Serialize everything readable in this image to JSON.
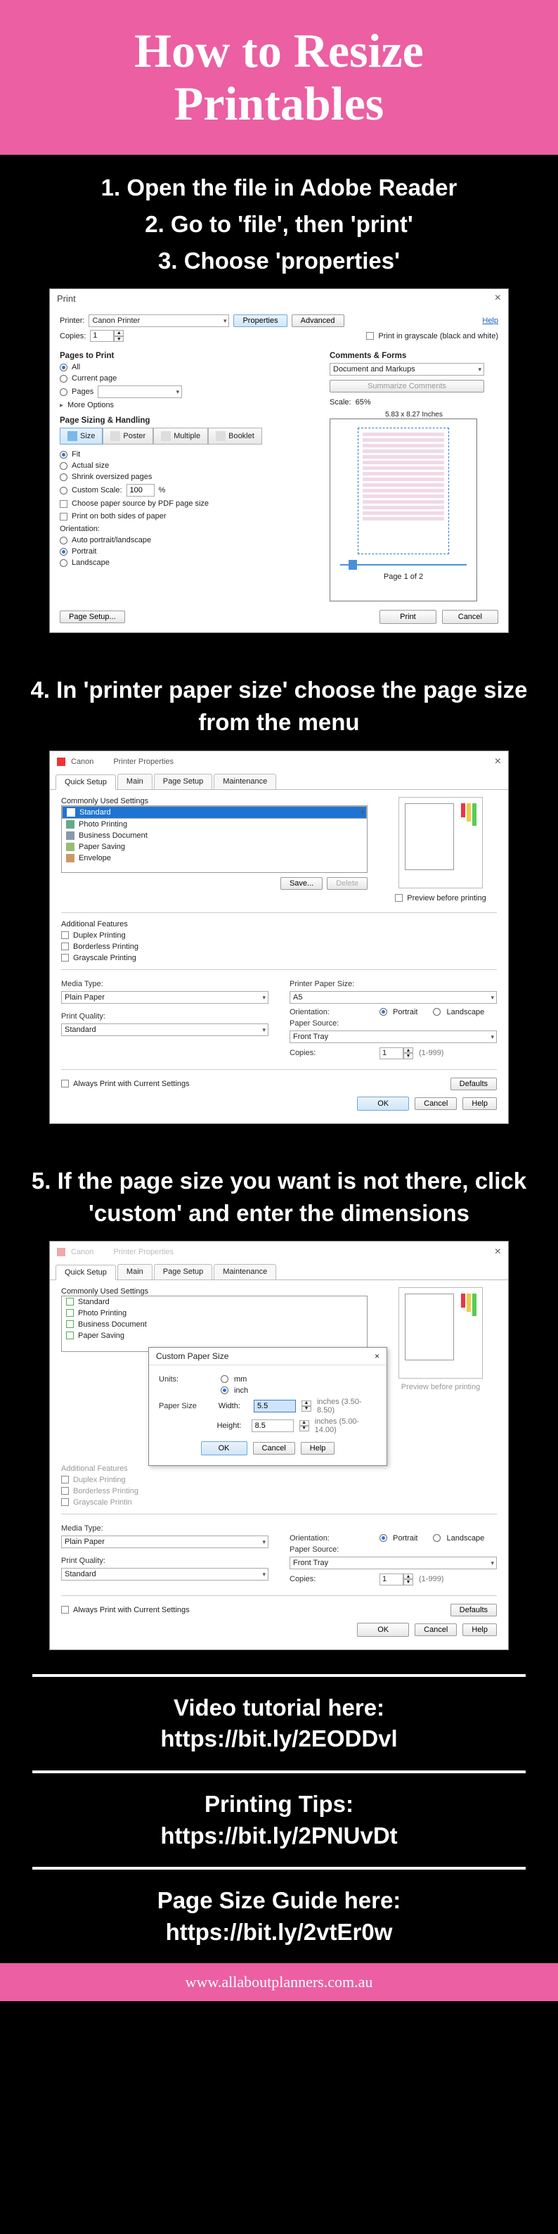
{
  "header": {
    "line1": "How to Resize",
    "line2": "Printables"
  },
  "steps": {
    "s1": "1. Open the file in Adobe Reader",
    "s2": "2. Go to 'file', then 'print'",
    "s3": "3. Choose 'properties'",
    "s4": "4. In 'printer paper size' choose the page size from the menu",
    "s5": "5. If the page size you want is not there, click 'custom' and enter the dimensions"
  },
  "print_dialog": {
    "title": "Print",
    "help": "Help",
    "printer_label": "Printer:",
    "printer_name": "Canon          Printer",
    "copies_label": "Copies:",
    "copies": "1",
    "properties_btn": "Properties",
    "advanced_btn": "Advanced",
    "grayscale": "Print in grayscale (black and white)",
    "pages_section": "Pages to Print",
    "all": "All",
    "current": "Current page",
    "pages": "Pages",
    "more_options": "More Options",
    "comments_section": "Comments & Forms",
    "comments_value": "Document and Markups",
    "summarize": "Summarize Comments",
    "scale_label": "Scale:",
    "scale_value": "65%",
    "doc_size": "5.83 x 8.27 Inches",
    "sizing_section": "Page Sizing & Handling",
    "tabs": {
      "size": "Size",
      "poster": "Poster",
      "multiple": "Multiple",
      "booklet": "Booklet"
    },
    "fit": "Fit",
    "actual": "Actual size",
    "shrink": "Shrink oversized pages",
    "custom_scale": "Custom Scale:",
    "custom_scale_val": "100",
    "pct": "%",
    "choose_source": "Choose paper source by PDF page size",
    "both_sides": "Print on both sides of paper",
    "orientation": "Orientation:",
    "auto": "Auto portrait/landscape",
    "portrait": "Portrait",
    "landscape": "Landscape",
    "page_of": "Page 1 of 2",
    "page_setup": "Page Setup...",
    "print_btn": "Print",
    "cancel_btn": "Cancel"
  },
  "pp": {
    "vendor": "Canon",
    "title": "Printer Properties",
    "tabs": {
      "quick": "Quick Setup",
      "main": "Main",
      "page": "Page Setup",
      "maint": "Maintenance"
    },
    "commonly": "Commonly Used Settings",
    "items": [
      "Standard",
      "Photo Printing",
      "Business Document",
      "Paper Saving",
      "Envelope"
    ],
    "save": "Save...",
    "delete": "Delete",
    "preview_chk": "Preview before printing",
    "additional": "Additional Features",
    "duplex": "Duplex Printing",
    "borderless": "Borderless Printing",
    "grayscale": "Grayscale Printing",
    "media_label": "Media Type:",
    "media_value": "Plain Paper",
    "paper_size_label": "Printer Paper Size:",
    "paper_size_value": "A5",
    "orientation": "Orientation:",
    "portrait": "Portrait",
    "landscape": "Landscape",
    "quality_label": "Print Quality:",
    "quality_value": "Standard",
    "source_label": "Paper Source:",
    "source_value": "Front Tray",
    "copies_label": "Copies:",
    "copies": "1",
    "copies_range": "(1-999)",
    "always": "Always Print with Current Settings",
    "defaults": "Defaults",
    "ok": "OK",
    "cancel": "Cancel",
    "help": "Help"
  },
  "custom": {
    "title": "Custom Paper Size",
    "units": "Units:",
    "mm": "mm",
    "inch": "inch",
    "paper_size": "Paper Size",
    "width_lbl": "Width:",
    "width": "5.5",
    "width_range": "inches (3.50-8.50)",
    "height_lbl": "Height:",
    "height": "8.5",
    "height_range": "inches (5.00-14.00)",
    "ok": "OK",
    "cancel": "Cancel",
    "help": "Help"
  },
  "links": {
    "video_label": "Video tutorial here:",
    "video_url": "https://bit.ly/2EODDvl",
    "tips_label": "Printing Tips:",
    "tips_url": "https://bit.ly/2PNUvDt",
    "guide_label": "Page Size Guide here:",
    "guide_url": "https://bit.ly/2vtEr0w"
  },
  "footer": "www.allaboutplanners.com.au"
}
